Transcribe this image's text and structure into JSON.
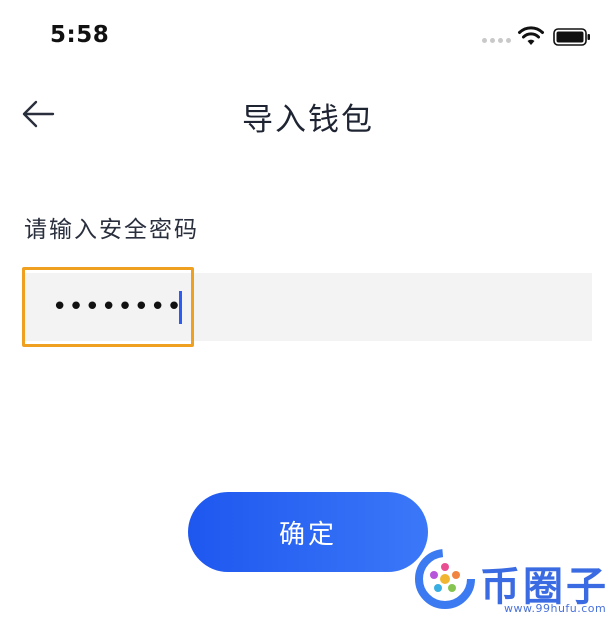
{
  "status_bar": {
    "time": "5:58",
    "wifi_icon": "wifi-icon",
    "battery_icon": "battery-icon"
  },
  "nav": {
    "back_icon": "arrow-left-icon",
    "title": "导入钱包"
  },
  "form": {
    "label": "请输入安全密码",
    "password_value": "********",
    "highlight_color": "#f0a020"
  },
  "actions": {
    "confirm_label": "确定",
    "accent_color": "#1e57ef"
  },
  "watermark": {
    "text": "币圈子",
    "url": "www.99hufu.com"
  }
}
